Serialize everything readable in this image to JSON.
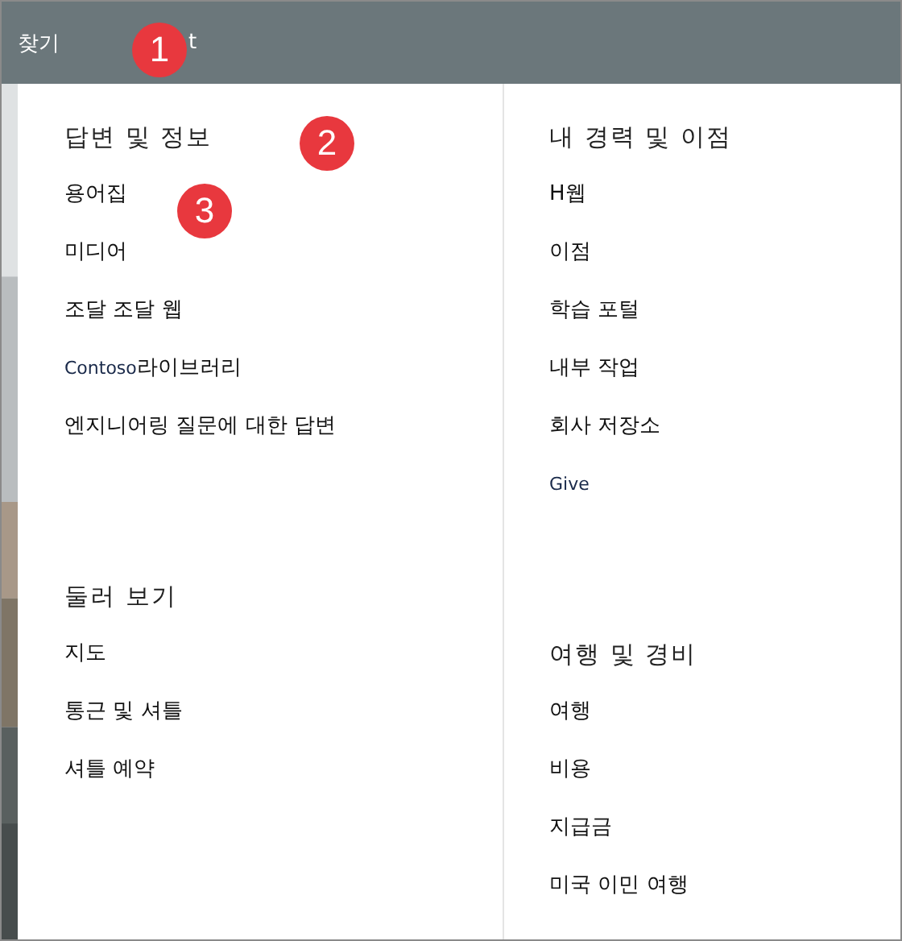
{
  "top_bar": {
    "items": [
      {
        "label": "찾기"
      },
      {
        "label": "t"
      }
    ]
  },
  "callouts": [
    {
      "number": "1"
    },
    {
      "number": "2"
    },
    {
      "number": "3"
    }
  ],
  "columns": [
    {
      "sections": [
        {
          "heading": "답변 및 정보",
          "items": [
            {
              "label": "용어집"
            },
            {
              "label": "미디어"
            },
            {
              "label": "조달 조달 웹"
            },
            {
              "prefix": "Contoso",
              "label": "라이브러리"
            },
            {
              "label": "엔지니어링 질문에 대한 답변"
            }
          ]
        },
        {
          "heading": "둘러 보기",
          "items": [
            {
              "label": "지도"
            },
            {
              "label": "통근 및 셔틀"
            },
            {
              "label": "셔틀 예약"
            }
          ]
        }
      ]
    },
    {
      "sections": [
        {
          "heading": "내 경력 및 이점",
          "items": [
            {
              "label": "H웹"
            },
            {
              "label": "이점"
            },
            {
              "label": "학습 포털"
            },
            {
              "label": "내부 작업"
            },
            {
              "label": "회사 저장소"
            },
            {
              "label": "Give",
              "kind": "latin"
            }
          ]
        },
        {
          "heading": "여행 및 경비",
          "items": [
            {
              "label": "여행"
            },
            {
              "label": "비용"
            },
            {
              "label": "지급금"
            },
            {
              "label": "미국 이민 여행"
            }
          ]
        }
      ]
    }
  ]
}
